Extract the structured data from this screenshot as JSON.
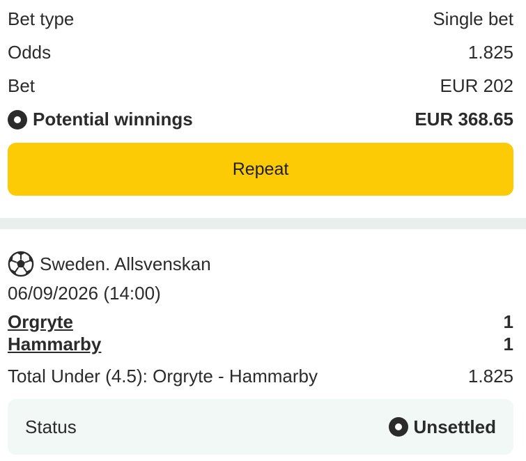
{
  "summary": {
    "bet_type_label": "Bet type",
    "bet_type_value": "Single bet",
    "odds_label": "Odds",
    "odds_value": "1.825",
    "bet_label": "Bet",
    "bet_value": "EUR 202",
    "winnings_label": "Potential winnings",
    "winnings_value": "EUR 368.65",
    "winnings_icon": "radio-dot-icon"
  },
  "actions": {
    "repeat_label": "Repeat"
  },
  "colors": {
    "accent": "#fccb06",
    "divider": "#e8efed",
    "status_bg": "#f1f8f6",
    "text": "#2b2b2b"
  },
  "event": {
    "sport_icon": "soccer-ball-icon",
    "league": "Sweden. Allsvenskan",
    "datetime": "06/09/2026 (14:00)",
    "teams": [
      {
        "name": "Orgryte",
        "score": "1"
      },
      {
        "name": "Hammarby",
        "score": "1"
      }
    ],
    "market": "Total Under (4.5): Orgryte - Hammarby",
    "market_odds": "1.825",
    "status_label": "Status",
    "status_value": "Unsettled",
    "status_icon": "radio-dot-icon"
  }
}
